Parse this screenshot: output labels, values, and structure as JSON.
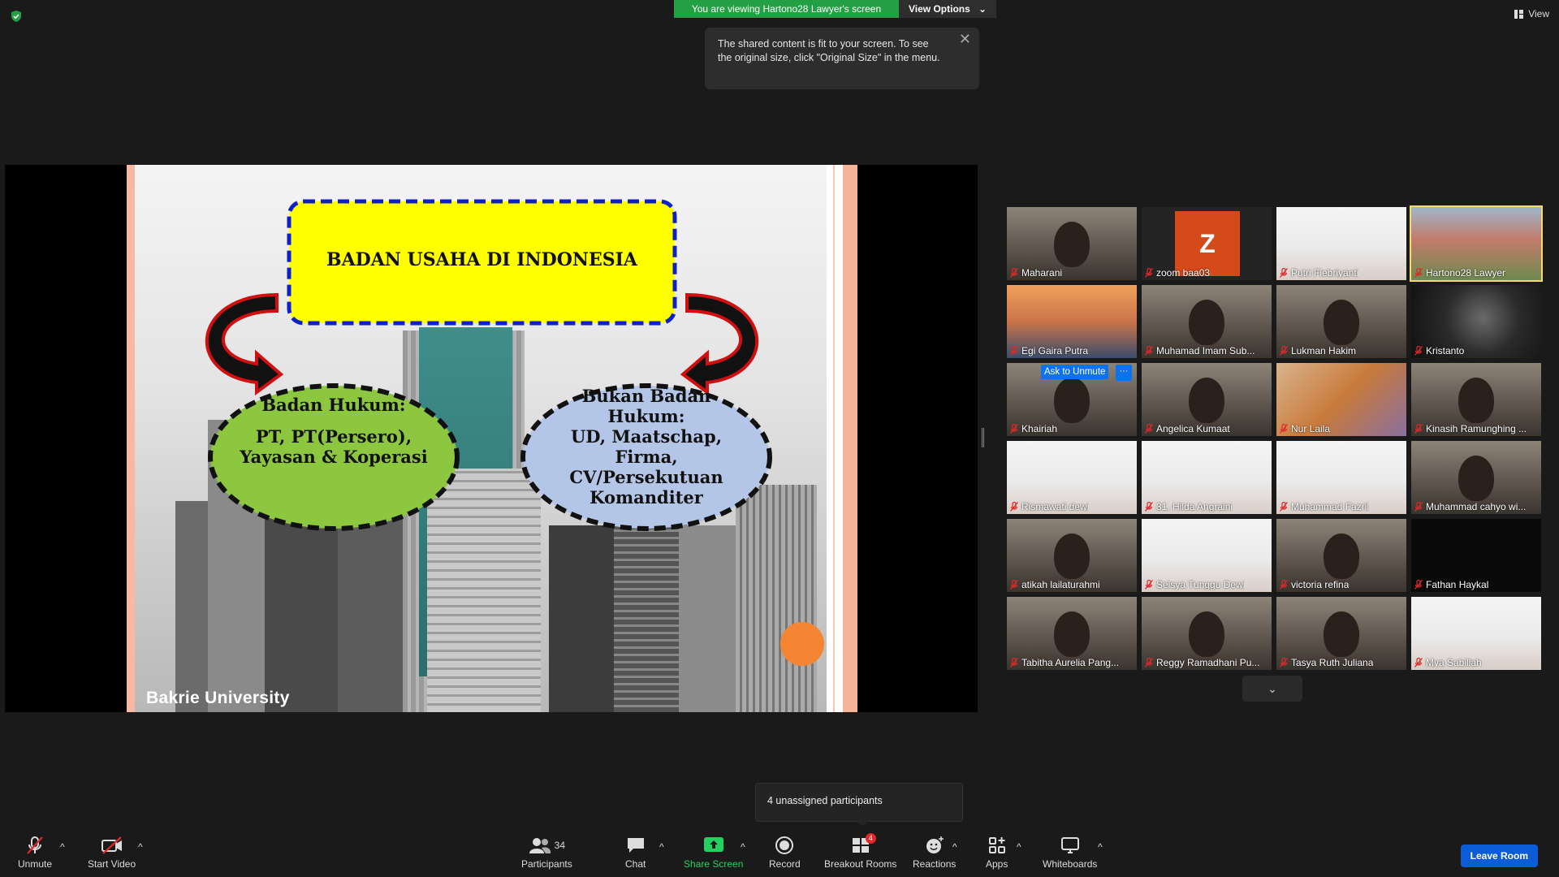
{
  "banner": {
    "viewing_text": "You are viewing Hartono28 Lawyer's screen",
    "view_options": "View Options",
    "view_options_caret": "⌄",
    "top_right_view": "View"
  },
  "tooltip": {
    "text": "The shared content is fit to your screen. To see the original size, click \"Original Size\" in the menu.",
    "close": "✕"
  },
  "slide": {
    "title": "BADAN USAHA DI INDONESIA",
    "left_oval_heading": "Badan Hukum:",
    "left_oval_body": "PT, PT(Persero), Yayasan & Koperasi",
    "right_oval_heading": "Bukan Badan Hukum:",
    "right_oval_body": "UD, Maatschap, Firma, CV/Persekutuan Komanditer",
    "footer": "Bakrie  University"
  },
  "gallery": {
    "participants": [
      {
        "name": "Maharani",
        "type": "face"
      },
      {
        "name": "zoom baa03",
        "type": "avatar",
        "initial": "Z"
      },
      {
        "name": "Putri Fiebriyanti",
        "type": "slide"
      },
      {
        "name": "Hartono28 Lawyer",
        "type": "landscape",
        "active": true
      },
      {
        "name": "Egi Gaira Putra",
        "type": "sunset"
      },
      {
        "name": "Muhamad Imam Sub...",
        "type": "face"
      },
      {
        "name": "Lukman Hakim",
        "type": "face"
      },
      {
        "name": "Kristanto",
        "type": "dark"
      },
      {
        "name": "Khairiah",
        "type": "face",
        "ask_unmute": "Ask to Unmute",
        "more": "···"
      },
      {
        "name": "Angelica Kumaat",
        "type": "face"
      },
      {
        "name": "Nur Laila",
        "type": "blur"
      },
      {
        "name": "Kinasih Ramunghing ...",
        "type": "face"
      },
      {
        "name": "Rismawati dewi",
        "type": "slide"
      },
      {
        "name": "31. Hilda Angraini",
        "type": "slide"
      },
      {
        "name": "Muhammad Fazril",
        "type": "slide"
      },
      {
        "name": "Muhammad cahyo wi...",
        "type": "face"
      },
      {
        "name": "atikah lailaturahmi",
        "type": "face"
      },
      {
        "name": "Seisya Tunggu Dewi",
        "type": "slide"
      },
      {
        "name": "victoria refina",
        "type": "face"
      },
      {
        "name": "Fathan Haykal",
        "type": "black"
      },
      {
        "name": "Tabitha Aurelia Pang...",
        "type": "face"
      },
      {
        "name": "Reggy Ramadhani Pu...",
        "type": "face"
      },
      {
        "name": "Tasya Ruth Juliana",
        "type": "face"
      },
      {
        "name": "Mya Sabillah",
        "type": "slide"
      }
    ],
    "next_page": "⌄"
  },
  "unassigned": "4 unassigned participants",
  "toolbar": {
    "unmute": "Unmute",
    "start_video": "Start Video",
    "participants": "Participants",
    "participants_count": "34",
    "chat": "Chat",
    "share_screen": "Share Screen",
    "record": "Record",
    "breakout_rooms": "Breakout Rooms",
    "breakout_badge": "4",
    "reactions": "Reactions",
    "apps": "Apps",
    "whiteboards": "Whiteboards",
    "leave_room": "Leave Room",
    "caret": "^"
  },
  "colors": {
    "accent_green": "#23a044",
    "leave_blue": "#0b5cd7",
    "active_tile_border": "#f5d96b",
    "slide_yellow": "#ffff00",
    "oval_green": "#8dc63f",
    "oval_blue": "#b4c6e7"
  }
}
